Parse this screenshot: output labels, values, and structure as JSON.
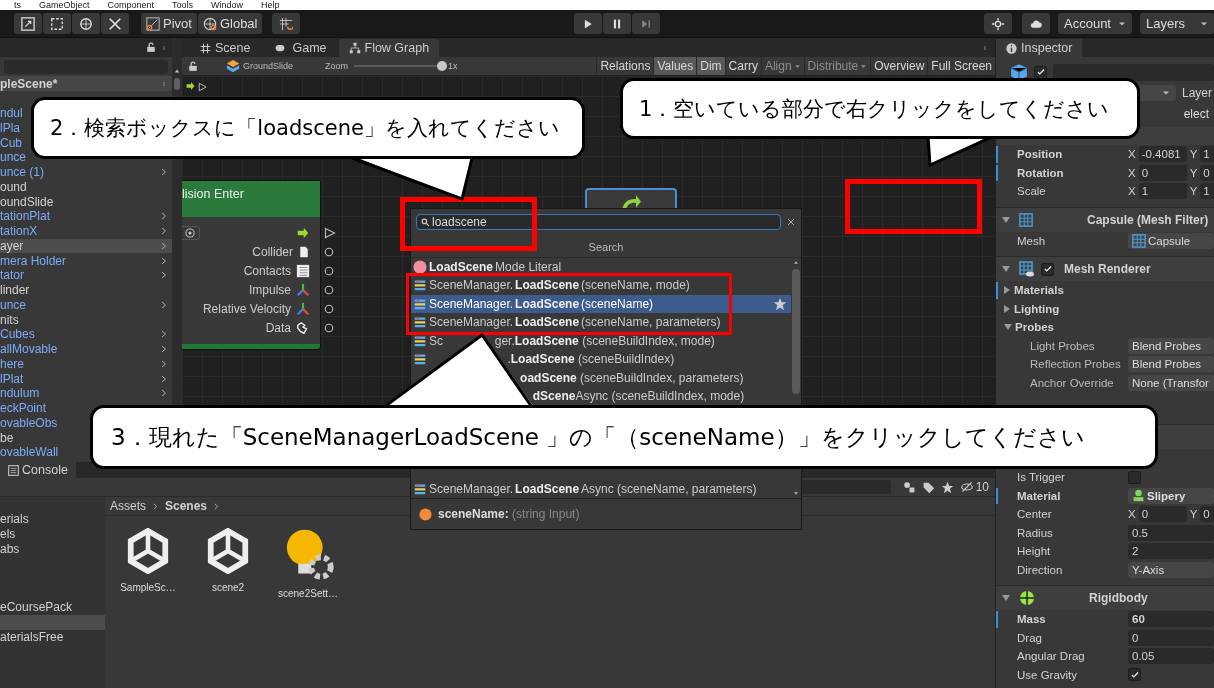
{
  "menu": [
    "ts",
    "GameObject",
    "Component",
    "Tools",
    "Window",
    "Help"
  ],
  "toolbar": {
    "pivot": "Pivot",
    "global": "Global",
    "account": "Account",
    "layers": "Layers"
  },
  "hierarchy": {
    "scene": "pleScene*",
    "items": [
      {
        "label": "ndul",
        "kind": "prefab",
        "has_children": false,
        "selected": false
      },
      {
        "label": "lPla",
        "kind": "prefab",
        "has_children": false,
        "selected": false
      },
      {
        "label": "Cub",
        "kind": "prefab",
        "has_children": false,
        "selected": false
      },
      {
        "label": "unce",
        "kind": "prefab",
        "has_children": false,
        "selected": false
      },
      {
        "label": "unce (1)",
        "kind": "prefab",
        "has_children": true,
        "selected": false
      },
      {
        "label": "ound",
        "kind": "object",
        "has_children": false,
        "selected": false
      },
      {
        "label": "oundSlide",
        "kind": "object",
        "has_children": false,
        "selected": false
      },
      {
        "label": "tationPlat",
        "kind": "prefab",
        "has_children": true,
        "selected": false
      },
      {
        "label": "tationX",
        "kind": "prefab",
        "has_children": true,
        "selected": false
      },
      {
        "label": "ayer",
        "kind": "object",
        "has_children": true,
        "selected": true
      },
      {
        "label": "mera Holder",
        "kind": "prefab",
        "has_children": true,
        "selected": false
      },
      {
        "label": "tator",
        "kind": "prefab",
        "has_children": true,
        "selected": false
      },
      {
        "label": "linder",
        "kind": "object",
        "has_children": false,
        "selected": false
      },
      {
        "label": "unce",
        "kind": "prefab",
        "has_children": true,
        "selected": false
      },
      {
        "label": "nits",
        "kind": "object",
        "has_children": false,
        "selected": false
      },
      {
        "label": "Cubes",
        "kind": "prefab",
        "has_children": true,
        "selected": false
      },
      {
        "label": "allMovable",
        "kind": "prefab",
        "has_children": true,
        "selected": false
      },
      {
        "label": "here",
        "kind": "prefab",
        "has_children": true,
        "selected": false
      },
      {
        "label": "lPlat",
        "kind": "prefab",
        "has_children": true,
        "selected": false
      },
      {
        "label": "ndulum",
        "kind": "prefab",
        "has_children": true,
        "selected": false
      },
      {
        "label": "eckPoint",
        "kind": "prefab",
        "has_children": false,
        "selected": false
      },
      {
        "label": "ovableObs",
        "kind": "prefab",
        "has_children": false,
        "selected": false
      },
      {
        "label": "be",
        "kind": "object",
        "has_children": false,
        "selected": false
      },
      {
        "label": "ovableWall",
        "kind": "prefab",
        "has_children": false,
        "selected": false
      }
    ]
  },
  "scene_tabs": [
    {
      "label": "Scene",
      "selected": false
    },
    {
      "label": "Game",
      "selected": false
    },
    {
      "label": "Flow Graph",
      "selected": true
    }
  ],
  "graph_toolbar": {
    "asset": "GroundSlide",
    "zoom_label": "Zoom",
    "zoom": {
      "level": 1
    },
    "zoom_value": "1x",
    "buttons": [
      {
        "label": "Relations",
        "on": false,
        "disabled": false,
        "dropdown": false
      },
      {
        "label": "Values",
        "on": true,
        "disabled": false,
        "dropdown": false
      },
      {
        "label": "Dim",
        "on": true,
        "disabled": false,
        "dropdown": false
      },
      {
        "label": "Carry",
        "on": false,
        "disabled": false,
        "dropdown": false
      },
      {
        "label": "Align",
        "on": false,
        "disabled": true,
        "dropdown": true
      },
      {
        "label": "Distribute",
        "on": false,
        "disabled": true,
        "dropdown": true
      },
      {
        "label": "Overview",
        "on": false,
        "disabled": false,
        "dropdown": false
      },
      {
        "label": "Full Screen",
        "on": false,
        "disabled": false,
        "dropdown": false
      }
    ]
  },
  "graph": {
    "node": {
      "title": "lision Enter",
      "ports": [
        {
          "label": "Collider",
          "kind": "file"
        },
        {
          "label": "Contacts",
          "kind": "list"
        },
        {
          "label": "Impulse",
          "kind": "axes"
        },
        {
          "label": "Relative Velocity",
          "kind": "axes"
        },
        {
          "label": "Data",
          "kind": "puzzle"
        }
      ]
    }
  },
  "popup": {
    "query": "loadscene",
    "title": "Search",
    "results": [
      {
        "text": "**LoadScene**Mode Literal",
        "kind": "literal",
        "selected": false
      },
      {
        "text": "SceneManager.**LoadScene** (sceneName, mode)",
        "kind": "method",
        "selected": false
      },
      {
        "text": "SceneManager.**LoadScene** (sceneName)",
        "kind": "method",
        "selected": true
      },
      {
        "text": "SceneManager.**LoadScene** (sceneName, parameters)",
        "kind": "method",
        "selected": false
      },
      {
        "lead": "Sc",
        "text": "ger.**LoadScene** (sceneBuildIndex, mode)",
        "kind": "method",
        "selected": false
      },
      {
        "text": ".**LoadScene** (sceneBuildIndex)",
        "kind": "method",
        "selected": false
      },
      {
        "text": "**oadScene** (sceneBuildIndex, parameters)",
        "selected": false
      },
      {
        "text": "**dScene**Async (sceneBuildIndex, mode)",
        "selected": false
      }
    ],
    "results_lower": [
      {
        "text": "SceneManager.**LoadScene**Async (sceneName, parameters)",
        "kind": "method",
        "selected": false
      }
    ],
    "footer": {
      "name": "sceneName:",
      "type": "(string Input)"
    }
  },
  "inspector": {
    "tab": "Inspector",
    "object_active": true,
    "layer_label": "Layer",
    "select_button": "elect",
    "components": [
      {
        "kind": "transform",
        "rows": [
          {
            "kind": "vector",
            "label": "Position",
            "overridden": true,
            "axes": [
              {
                "axis": "X",
                "value": "-0.4081"
              },
              {
                "axis": "Y",
                "value": "1"
              }
            ]
          },
          {
            "kind": "vector",
            "label": "Rotation",
            "overridden": true,
            "axes": [
              {
                "axis": "X",
                "value": "0"
              },
              {
                "axis": "Y",
                "value": "0"
              }
            ]
          },
          {
            "kind": "vector",
            "label": "Scale",
            "overridden": false,
            "axes": [
              {
                "axis": "X",
                "value": "1"
              },
              {
                "axis": "Y",
                "value": "1"
              }
            ]
          }
        ]
      },
      {
        "kind": "mesh_filter",
        "title": "Capsule (Mesh Filter)",
        "rows": [
          {
            "kind": "mesh_ref",
            "label": "Mesh",
            "value": "Capsule",
            "overridden": false
          }
        ]
      },
      {
        "kind": "mesh_renderer",
        "title": "Mesh Renderer",
        "enabled": true,
        "rows": [
          {
            "kind": "foldout",
            "label": "Materials",
            "expanded": false,
            "overridden": true
          },
          {
            "kind": "foldout",
            "label": "Lighting",
            "expanded": false,
            "overridden": false
          },
          {
            "kind": "foldout",
            "label": "Probes",
            "expanded": true,
            "overridden": false
          },
          {
            "kind": "dropdown",
            "label": "Light Probes",
            "value": "Blend Probes",
            "indent": true
          },
          {
            "kind": "dropdown",
            "label": "Reflection Probes",
            "value": "Blend Probes",
            "indent": true
          },
          {
            "kind": "dropdown",
            "label": "Anchor Override",
            "value": "None (Transfor",
            "indent": true
          }
        ]
      },
      {
        "kind": "covered",
        "rows": [
          {
            "kind": "checkbox",
            "label": "Is Trigger",
            "checked": false,
            "overridden": false
          },
          {
            "kind": "material_ref",
            "label": "Material",
            "value": "Slipery",
            "overridden": true
          },
          {
            "kind": "vector",
            "label": "Center",
            "overridden": false,
            "axes": [
              {
                "axis": "X",
                "value": "0"
              },
              {
                "axis": "Y",
                "value": "0"
              }
            ]
          },
          {
            "kind": "text",
            "label": "Radius",
            "value": "0.5",
            "overridden": false
          },
          {
            "kind": "text",
            "label": "Height",
            "value": "2",
            "overridden": false
          },
          {
            "kind": "dropdown",
            "label": "Direction",
            "value": "Y-Axis",
            "indent": false
          }
        ]
      },
      {
        "kind": "rigidbody",
        "title": "Rigidbody",
        "rows": [
          {
            "kind": "text",
            "label": "Mass",
            "value": "60",
            "overridden": true
          },
          {
            "kind": "text",
            "label": "Drag",
            "value": "0",
            "overridden": false
          },
          {
            "kind": "text",
            "label": "Angular Drag",
            "value": "0.05",
            "overridden": false
          },
          {
            "kind": "checkbox",
            "label": "Use Gravity",
            "checked": true,
            "overridden": false
          }
        ]
      }
    ]
  },
  "project": {
    "tab": "Console",
    "count": "10",
    "folders": [
      {
        "label": "erials",
        "selected": false
      },
      {
        "label": "els",
        "selected": false
      },
      {
        "label": "abs",
        "selected": false
      },
      {
        "selected": false
      },
      {
        "selected": false
      },
      {
        "selected": false
      },
      {
        "label": "eCoursePack",
        "selected": false
      },
      {
        "selected": true
      },
      {
        "label": "aterialsFree",
        "selected": false
      }
    ],
    "breadcrumb": [
      "Assets",
      "Scenes"
    ],
    "assets": [
      {
        "name": "SampleSc…",
        "kind": "scene"
      },
      {
        "name": "scene2",
        "kind": "scene"
      },
      {
        "name": "scene2Sett…",
        "kind": "lighting"
      }
    ]
  },
  "callouts": [
    {
      "text": "1．空いている部分で右クリックをしてください"
    },
    {
      "text": "2．検索ボックスに「loadscene」を入れてください"
    },
    {
      "text": "3．現れた「SceneManagerLoadScene 」の「（sceneName）」をクリックしてください"
    }
  ]
}
